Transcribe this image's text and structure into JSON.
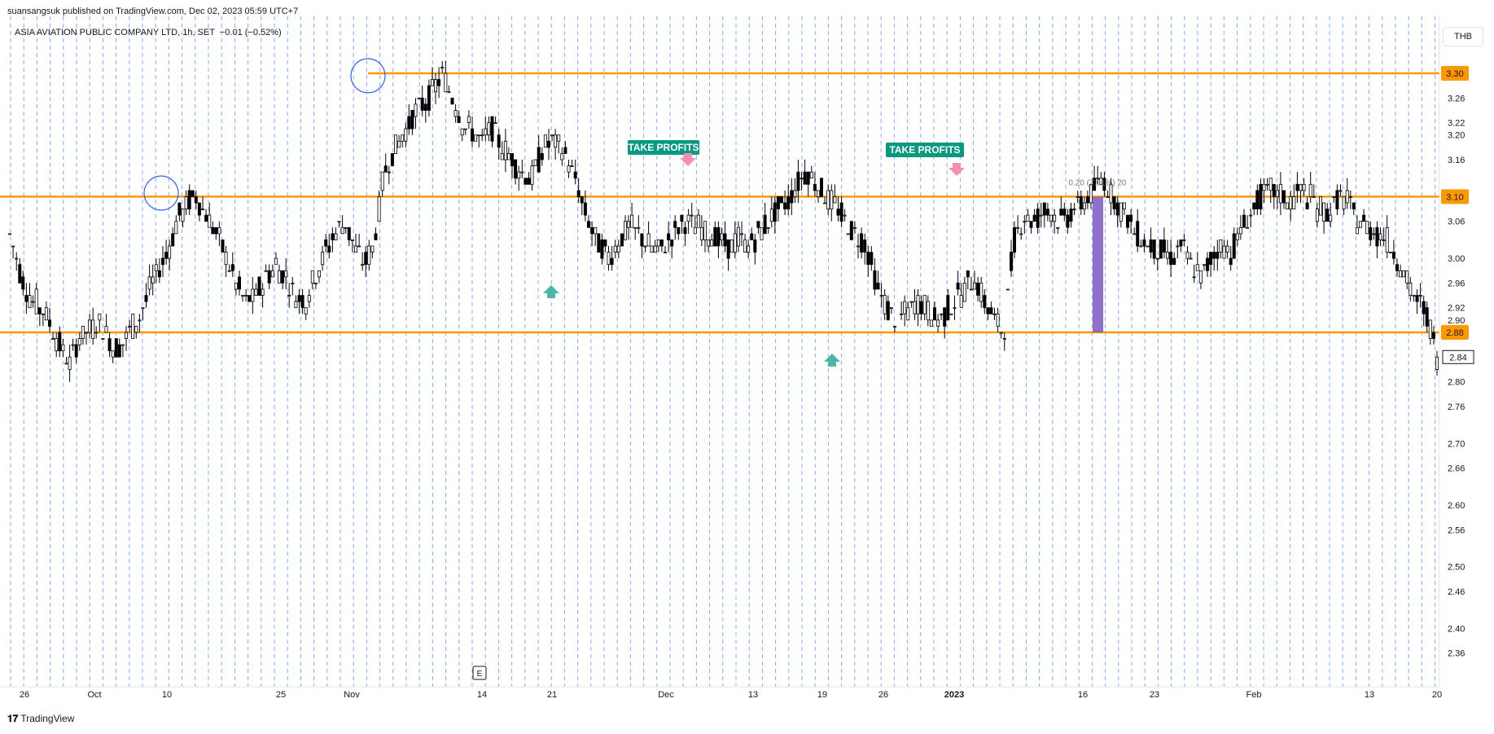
{
  "header": {
    "publisher": "suansangsuk published on TradingView.com, Dec 02, 2023 05:59 UTC+7",
    "symbol": "ASIA AVIATION PUBLIC COMPANY LTD, 1h, SET",
    "change": "−0.01 (−0.52%)"
  },
  "currency": "THB",
  "brand": "TradingView",
  "chart_data": {
    "type": "candlestick",
    "y_ticks": [
      "3.26",
      "3.22",
      "3.20",
      "3.16",
      "3.06",
      "3.00",
      "2.96",
      "2.92",
      "2.90",
      "2.84",
      "2.80",
      "2.76",
      "2.70",
      "2.66",
      "2.60",
      "2.56",
      "2.50",
      "2.46",
      "2.40",
      "2.36"
    ],
    "ylim": [
      2.33,
      3.35
    ],
    "x_ticks": [
      {
        "label": "26",
        "bold": false
      },
      {
        "label": "Oct",
        "bold": false
      },
      {
        "label": "10",
        "bold": false
      },
      {
        "label": "25",
        "bold": false
      },
      {
        "label": "Nov",
        "bold": false
      },
      {
        "label": "14",
        "bold": false
      },
      {
        "label": "21",
        "bold": false
      },
      {
        "label": "Dec",
        "bold": false
      },
      {
        "label": "13",
        "bold": false
      },
      {
        "label": "19",
        "bold": false
      },
      {
        "label": "26",
        "bold": false
      },
      {
        "label": "2023",
        "bold": true
      },
      {
        "label": "16",
        "bold": false
      },
      {
        "label": "23",
        "bold": false
      },
      {
        "label": "Feb",
        "bold": false
      },
      {
        "label": "13",
        "bold": false
      },
      {
        "label": "20",
        "bold": false
      }
    ],
    "levels": [
      {
        "price": 3.3,
        "label": "3.30"
      },
      {
        "price": 3.1,
        "label": "3.10"
      },
      {
        "price": 2.88,
        "label": "2.88"
      }
    ],
    "last_price": {
      "price": 2.84,
      "label": "2.84"
    },
    "level_color": "#ff9800",
    "annotations": [
      {
        "text": "TAKE PROFITS",
        "color": "#089981"
      },
      {
        "text": "TAKE PROFITS",
        "color": "#089981"
      }
    ],
    "measure": {
      "text": "0.20 (7.01%) 20",
      "from": 2.88,
      "to": 3.1,
      "color": "#7e57c2"
    },
    "earnings_marker": "E",
    "price_path": [
      3.04,
      2.98,
      2.94,
      2.92,
      2.9,
      2.86,
      2.83,
      2.87,
      2.88,
      2.9,
      2.87,
      2.85,
      2.88,
      2.9,
      2.94,
      2.98,
      3.01,
      3.06,
      3.09,
      3.1,
      3.07,
      3.04,
      3.0,
      2.96,
      2.93,
      2.94,
      2.97,
      2.99,
      2.97,
      2.94,
      2.93,
      2.97,
      3.01,
      3.04,
      3.06,
      3.02,
      2.99,
      3.02,
      3.14,
      3.17,
      3.2,
      3.23,
      3.25,
      3.27,
      3.3,
      3.26,
      3.22,
      3.2,
      3.19,
      3.21,
      3.18,
      3.16,
      3.14,
      3.13,
      3.17,
      3.19,
      3.18,
      3.15,
      3.1,
      3.05,
      3.02,
      3.0,
      3.03,
      3.05,
      3.04,
      3.02,
      3.01,
      3.03,
      3.05,
      3.06,
      3.05,
      3.04,
      3.03,
      3.02,
      3.03,
      3.02,
      3.04,
      3.06,
      3.08,
      3.09,
      3.12,
      3.14,
      3.12,
      3.1,
      3.08,
      3.06,
      3.04,
      3.02,
      2.96,
      2.92,
      2.9,
      2.91,
      2.93,
      2.92,
      2.9,
      2.91,
      2.93,
      2.95,
      2.97,
      2.93,
      2.9,
      2.88,
      3.03,
      3.07,
      3.06,
      3.08,
      3.07,
      3.06,
      3.08,
      3.09,
      3.11,
      3.13,
      3.1,
      3.08,
      3.05,
      3.03,
      3.02,
      3.01,
      3.0,
      3.02,
      2.99,
      2.97,
      3.0,
      3.02,
      3.01,
      3.04,
      3.07,
      3.1,
      3.11,
      3.1,
      3.09,
      3.11,
      3.1,
      3.08,
      3.07,
      3.1,
      3.09,
      3.06,
      3.05,
      3.04,
      3.03,
      3.0,
      2.96,
      2.93,
      2.91,
      2.84
    ]
  }
}
